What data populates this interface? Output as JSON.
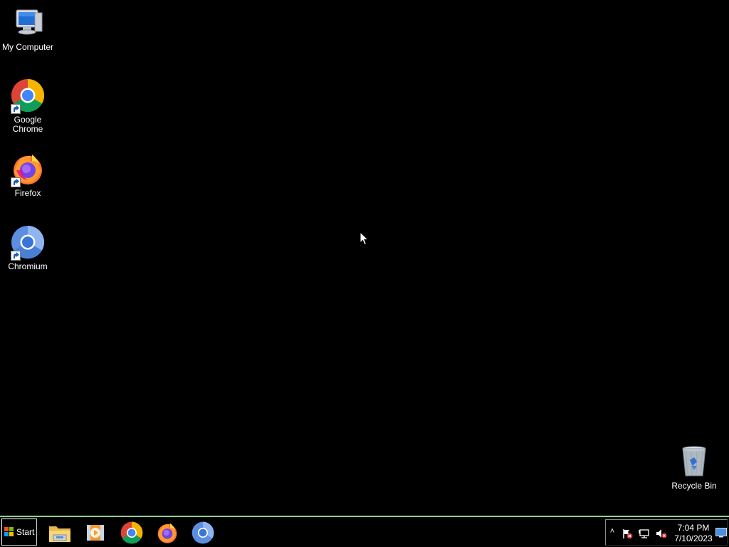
{
  "desktop": {
    "icons": [
      {
        "label": "My Computer",
        "icon": "computer-icon"
      },
      {
        "label": "Google Chrome",
        "icon": "chrome-icon",
        "shortcut": true
      },
      {
        "label": "Firefox",
        "icon": "firefox-icon",
        "shortcut": true
      },
      {
        "label": "Chromium",
        "icon": "chromium-icon",
        "shortcut": true
      },
      {
        "label": "Recycle Bin",
        "icon": "recycle-bin-icon"
      }
    ]
  },
  "taskbar": {
    "start_label": "Start",
    "pinned": [
      {
        "name": "explorer",
        "icon": "folder-icon"
      },
      {
        "name": "media-player",
        "icon": "media-player-icon"
      },
      {
        "name": "chrome",
        "icon": "chrome-icon"
      },
      {
        "name": "firefox",
        "icon": "firefox-icon"
      },
      {
        "name": "chromium",
        "icon": "chromium-icon"
      }
    ],
    "tray": {
      "icons": [
        "show-hidden-icons-chevron",
        "action-center-flag-icon",
        "network-icon",
        "volume-muted-icon"
      ],
      "time": "7:04 PM",
      "date": "7/10/2023"
    }
  },
  "colors": {
    "desktop_background": "#000000",
    "taskbar_top_border": "#8fd08f"
  }
}
